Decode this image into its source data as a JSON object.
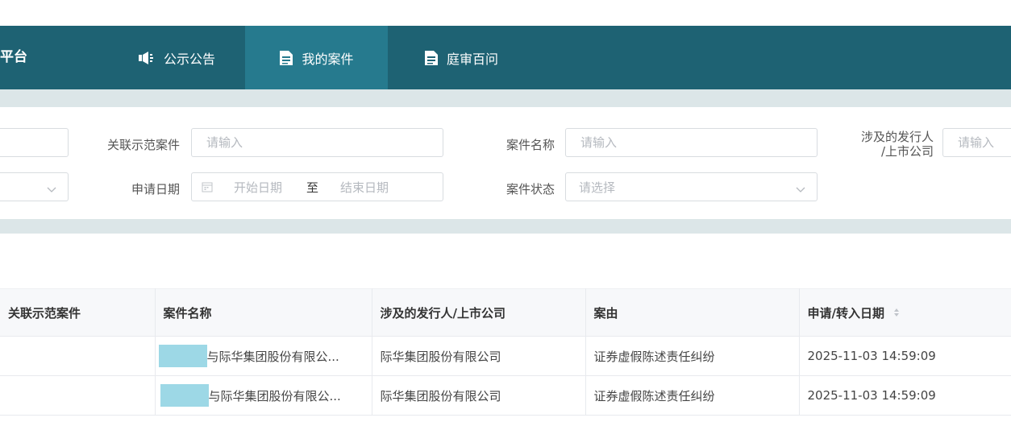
{
  "nav": {
    "brand": "平台",
    "items": [
      {
        "label": "公示公告",
        "icon": "megaphone-icon",
        "active": false
      },
      {
        "label": "我的案件",
        "icon": "document-icon",
        "active": true
      },
      {
        "label": "庭审百问",
        "icon": "document-icon",
        "active": false
      }
    ]
  },
  "filters": {
    "related_case_label": "关联示范案件",
    "related_case_placeholder": "请输入",
    "case_name_label": "案件名称",
    "case_name_placeholder": "请输入",
    "issuer_label_line1": "涉及的发行人",
    "issuer_label_line2": "/上市公司",
    "issuer_placeholder": "请输入",
    "apply_date_label": "申请日期",
    "start_date_placeholder": "开始日期",
    "date_separator": "至",
    "end_date_placeholder": "结束日期",
    "case_status_label": "案件状态",
    "case_status_placeholder": "请选择"
  },
  "table": {
    "headers": {
      "related_case": "关联示范案件",
      "case_name": "案件名称",
      "issuer": "涉及的发行人/上市公司",
      "cause": "案由",
      "apply_date": "申请/转入日期"
    },
    "rows": [
      {
        "related_case": "",
        "case_name": "与际华集团股份有限公...",
        "issuer": "际华集团股份有限公司",
        "cause": "证券虚假陈述责任纠纷",
        "apply_date": "2025-11-03 14:59:09"
      },
      {
        "related_case": "",
        "case_name": "与际华集团股份有限公...",
        "issuer": "际华集团股份有限公司",
        "cause": "证券虚假陈述责任纠纷",
        "apply_date": "2025-11-03 14:59:09"
      }
    ]
  },
  "colors": {
    "nav_bg": "#1e6273",
    "nav_active": "#267a8e",
    "strip": "#dce6e8",
    "redaction": "#9dd8e6"
  }
}
